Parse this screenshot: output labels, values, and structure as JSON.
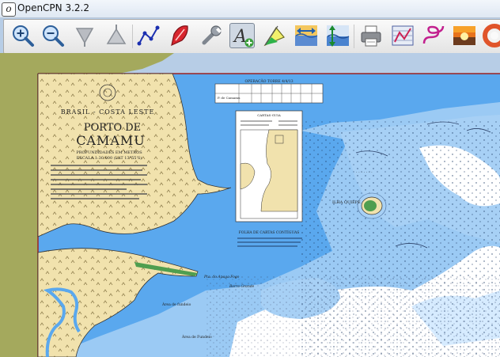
{
  "window": {
    "title": "OpenCPN 3.2.2",
    "app_icon_glyph": "o"
  },
  "toolbar": {
    "buttons": [
      {
        "name": "zoom-in-button",
        "icon": "magnifier-plus-icon"
      },
      {
        "name": "zoom-out-button",
        "icon": "magnifier-minus-icon"
      },
      {
        "name": "scale-in-button",
        "icon": "triangle-down-icon"
      },
      {
        "name": "scale-out-button",
        "icon": "triangle-up-icon"
      },
      {
        "name": "create-route-button",
        "icon": "route-icon"
      },
      {
        "name": "auto-follow-button",
        "icon": "ship-icon"
      },
      {
        "name": "settings-button",
        "icon": "wrench-icon"
      },
      {
        "name": "text-button",
        "icon": "text-plus-icon",
        "active": true
      },
      {
        "name": "current-button",
        "icon": "current-flag-icon"
      },
      {
        "name": "tides-button",
        "icon": "tide-arrows-icon"
      },
      {
        "name": "tide-height-button",
        "icon": "tide-height-icon"
      },
      {
        "name": "print-button",
        "icon": "printer-icon"
      },
      {
        "name": "route-manager-button",
        "icon": "route-manager-icon"
      },
      {
        "name": "track-button",
        "icon": "track-icon"
      },
      {
        "name": "color-scheme-button",
        "icon": "sunset-icon"
      },
      {
        "name": "mob-button",
        "icon": "lifebuoy-icon"
      }
    ]
  },
  "chart": {
    "title_line1": "BRASIL - COSTA LESTE",
    "title_line2": "PORTO DE",
    "title_line3": "CAMAMU",
    "subtitle_1": "PROFUNDIDADES EM METROS",
    "subtitle_2": "ESCALA 1:30 000 (LAT 13°55'S)",
    "table_header": "OPERACÃO TORRE 4/4/13",
    "table_row_label": "P. de Camamu",
    "inset_title": "CARTAS-GUIA",
    "island_label": "ILHA QUIEPE",
    "place_label_1": "Pta. do Apaga Fogo",
    "place_label_2": "Barra Grande",
    "magenta_label_1": "Área de fundeio",
    "magenta_label_2": "Área de Fundeio",
    "inset_footer": "FOLHA DE CARTAS CONTÍGUAS"
  },
  "colors": {
    "land": "#f1e2ad",
    "deep_water": "#5aa8ee",
    "shallow_water": "#a7d0f5",
    "drying": "#ffffff",
    "olive_land": "#a4a95d",
    "magenta": "#cc28c8",
    "outside_chart": "#b7cde6"
  }
}
